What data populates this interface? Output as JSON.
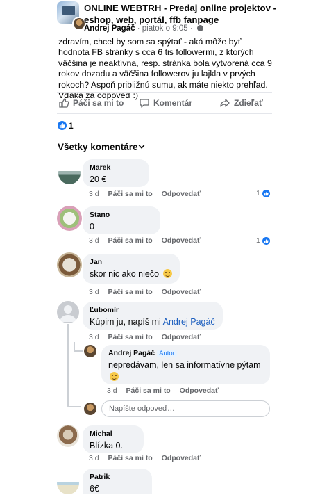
{
  "post": {
    "group_name": "ONLINE WEBTRH - Predaj online projektov - eshop, web, portál, ffb fanpage",
    "author": "Andrej Pagáč",
    "time": "piatok o 9:05",
    "body": "zdravím, chcel by som sa spýtať - aká môže byť hodnota FB stránky s cca 6 tis followermi, z ktorých väčšina je neaktívna, resp. stránka bola vytvorená cca 9 rokov dozadu a väčšina followerov ju lajkla v prvých rokoch? Aspoň približnú sumu, ak máte niekto prehľad. Vďaka za odpoveď :)",
    "separator": "·"
  },
  "actions": {
    "like": "Páči sa mi to",
    "comment": "Komentár",
    "share": "Zdieľať"
  },
  "reactions": {
    "count": "1"
  },
  "comments_header": {
    "sort_label": "Všetky komentáre"
  },
  "comments": [
    {
      "name": "Marek",
      "text": "20 €",
      "time": "3 d",
      "like": "Páči sa mi to",
      "reply": "Odpovedať",
      "reactions": "1"
    },
    {
      "name": "Stano",
      "text": "0",
      "time": "3 d",
      "like": "Páči sa mi to",
      "reply": "Odpovedať",
      "reactions": "1"
    },
    {
      "name": "Jan",
      "text": "skor nic ako niečo",
      "time": "3 d",
      "like": "Páči sa mi to",
      "reply": "Odpovedať"
    },
    {
      "name": "Ľubomír",
      "text": "Kúpim ju, napíš mi",
      "mention": "Andrej Pagáč",
      "time": "3 d",
      "like": "Páči sa mi to",
      "reply": "Odpovedať",
      "replies": [
        {
          "name": "Andrej Pagáč",
          "badge": "Autor",
          "text": "nepredávam, len sa informatívne pýtam",
          "time": "3 d",
          "like": "Páči sa mi to",
          "reply": "Odpovedať"
        }
      ]
    },
    {
      "name": "Michal",
      "text": "Blízka 0.",
      "time": "3 d",
      "like": "Páči sa mi to",
      "reply": "Odpovedať"
    },
    {
      "name": "Patrik",
      "text": "6€"
    }
  ],
  "reply_box": {
    "placeholder": "Napíšte odpoveď…"
  },
  "colors": {
    "accent": "#1877f2",
    "bubble": "#f0f2f5",
    "muted": "#65676b"
  }
}
